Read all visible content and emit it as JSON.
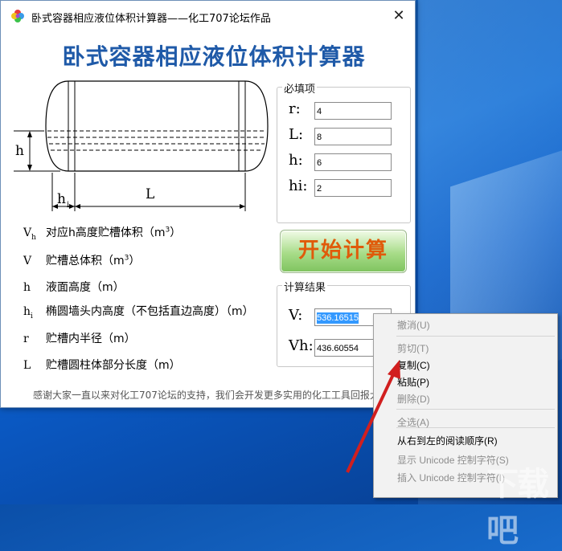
{
  "window": {
    "title": "卧式容器相应液位体积计算器——化工707论坛作品",
    "close_glyph": "✕"
  },
  "heading": "卧式容器相应液位体积计算器",
  "diagram": {
    "h_label": "h",
    "hi_label": "h",
    "hi_sub": "i",
    "L_label": "L"
  },
  "legend": [
    {
      "sym": "V",
      "sub": "h",
      "text": "对应h高度贮槽体积（m",
      "sup": "3",
      "tail": "）"
    },
    {
      "sym": "V",
      "sub": "",
      "text": "贮槽总体积（m",
      "sup": "3",
      "tail": "）"
    },
    {
      "sym": "h",
      "sub": "",
      "text": "液面高度（m）",
      "sup": "",
      "tail": ""
    },
    {
      "sym": "h",
      "sub": "i",
      "text": "椭圆墙头内高度（不包括直边高度）（m）",
      "sup": "",
      "tail": ""
    },
    {
      "sym": "r",
      "sub": "",
      "text": "贮槽内半径（m）",
      "sup": "",
      "tail": ""
    },
    {
      "sym": "L",
      "sub": "",
      "text": "贮槽圆柱体部分长度（m）",
      "sup": "",
      "tail": ""
    }
  ],
  "required": {
    "group_label": "必填项",
    "fields": [
      {
        "label": "r:",
        "value": "4"
      },
      {
        "label": "L:",
        "value": "8"
      },
      {
        "label": "h:",
        "value": "6"
      },
      {
        "label": "hi:",
        "value": "2"
      }
    ]
  },
  "start_button": "开始计算",
  "results": {
    "group_label": "计算结果",
    "fields": [
      {
        "label": "V:",
        "value": "536.16515"
      },
      {
        "label": "Vh:",
        "value": "436.60554"
      }
    ]
  },
  "thanks": "感谢大家一直以来对化工707论坛的支持，我们会开发更多实用的化工工具回报大家",
  "context_menu": [
    {
      "label": "撤消(U)",
      "enabled": false
    },
    {
      "label": "剪切(T)",
      "enabled": false
    },
    {
      "label": "复制(C)",
      "enabled": true
    },
    {
      "label": "粘贴(P)",
      "enabled": true
    },
    {
      "label": "删除(D)",
      "enabled": false
    },
    {
      "label": "全选(A)",
      "enabled": false
    },
    {
      "label": "从右到左的阅读顺序(R)",
      "enabled": true
    },
    {
      "label": "显示 Unicode 控制字符(S)",
      "enabled": false
    },
    {
      "label": "插入 Unicode 控制字符(I)",
      "enabled": false
    }
  ],
  "watermark": "下载吧",
  "colors": {
    "heading": "#1f5aa8",
    "start_text": "#e05a0a",
    "arrow": "#d11f1f",
    "selection": "#3399ff"
  }
}
